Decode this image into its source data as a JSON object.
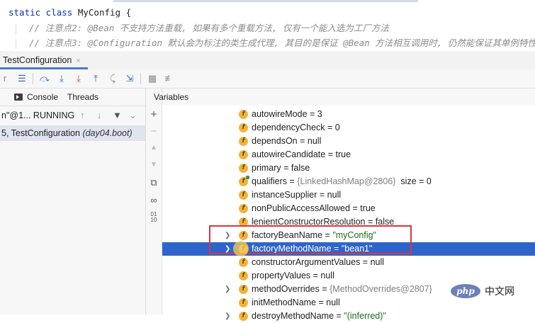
{
  "editor": {
    "line1_kw": "static class",
    "line1_name": "MyConfig {",
    "line2": "// 注意点2: @Bean 不支持方法重载, 如果有多个重载方法, 仅有一个能入选为工厂方法",
    "line3": "// 注意点3: @Configuration 默认会为标注的类生成代理, 其目的是保证 @Bean 方法相互调用时, 仍然能保证其单例特性"
  },
  "run_tab": {
    "label": "TestConfiguration",
    "close": "×"
  },
  "toolbar": {
    "icons": [
      "list-icon",
      "step-over-icon",
      "step-into-icon",
      "force-step-into-icon",
      "step-out-icon",
      "run-to-cursor-icon",
      "evaluate-icon",
      "table-icon",
      "settings-icon"
    ]
  },
  "debugger": {
    "tab_console": "Console",
    "tab_threads": "Threads",
    "thread_label": "n\"@1... RUNNING",
    "frame_prefix": "5, TestConfiguration",
    "frame_pkg": "(day04.boot)",
    "variables_header": "Variables"
  },
  "variables": [
    {
      "name": "autowireMode",
      "sep": " = ",
      "value": "3",
      "kind": "val",
      "expand": false
    },
    {
      "name": "dependencyCheck",
      "sep": " = ",
      "value": "0",
      "kind": "val",
      "expand": false
    },
    {
      "name": "dependsOn",
      "sep": " = ",
      "value": "null",
      "kind": "val",
      "expand": false
    },
    {
      "name": "autowireCandidate",
      "sep": " = ",
      "value": "true",
      "kind": "val",
      "expand": false
    },
    {
      "name": "primary",
      "sep": " = ",
      "value": "false",
      "kind": "val",
      "expand": false
    },
    {
      "name": "qualifiers",
      "sep": " = ",
      "value": "{LinkedHashMap@2806}",
      "extra": "  size = 0",
      "kind": "ref",
      "expand": false
    },
    {
      "name": "instanceSupplier",
      "sep": " = ",
      "value": "null",
      "kind": "val",
      "expand": false
    },
    {
      "name": "nonPublicAccessAllowed",
      "sep": " = ",
      "value": "true",
      "kind": "val",
      "expand": false
    },
    {
      "name": "lenientConstructorResolution",
      "sep": " = ",
      "value": "false",
      "kind": "val",
      "expand": false
    },
    {
      "name": "factoryBeanName",
      "sep": " = ",
      "value": "\"myConfig\"",
      "kind": "str",
      "expand": true
    },
    {
      "name": "factoryMethodName",
      "sep": " = ",
      "value": "\"bean1\"",
      "kind": "str",
      "expand": true,
      "selected": true
    },
    {
      "name": "constructorArgumentValues",
      "sep": " = ",
      "value": "null",
      "kind": "val",
      "expand": false
    },
    {
      "name": "propertyValues",
      "sep": " = ",
      "value": "null",
      "kind": "val",
      "expand": false
    },
    {
      "name": "methodOverrides",
      "sep": " = ",
      "value": "{MethodOverrides@2807}",
      "kind": "ref",
      "expand": true
    },
    {
      "name": "initMethodName",
      "sep": " = ",
      "value": "null",
      "kind": "val",
      "expand": false
    },
    {
      "name": "destroyMethodName",
      "sep": " = ",
      "value": "\"(inferred)\"",
      "kind": "str",
      "expand": true
    }
  ],
  "watermark": {
    "logo": "php",
    "text": "中文网"
  },
  "colors": {
    "selection": "#2f65ca",
    "highlight_border": "#d9363e",
    "field_icon": "#f0b43c"
  }
}
